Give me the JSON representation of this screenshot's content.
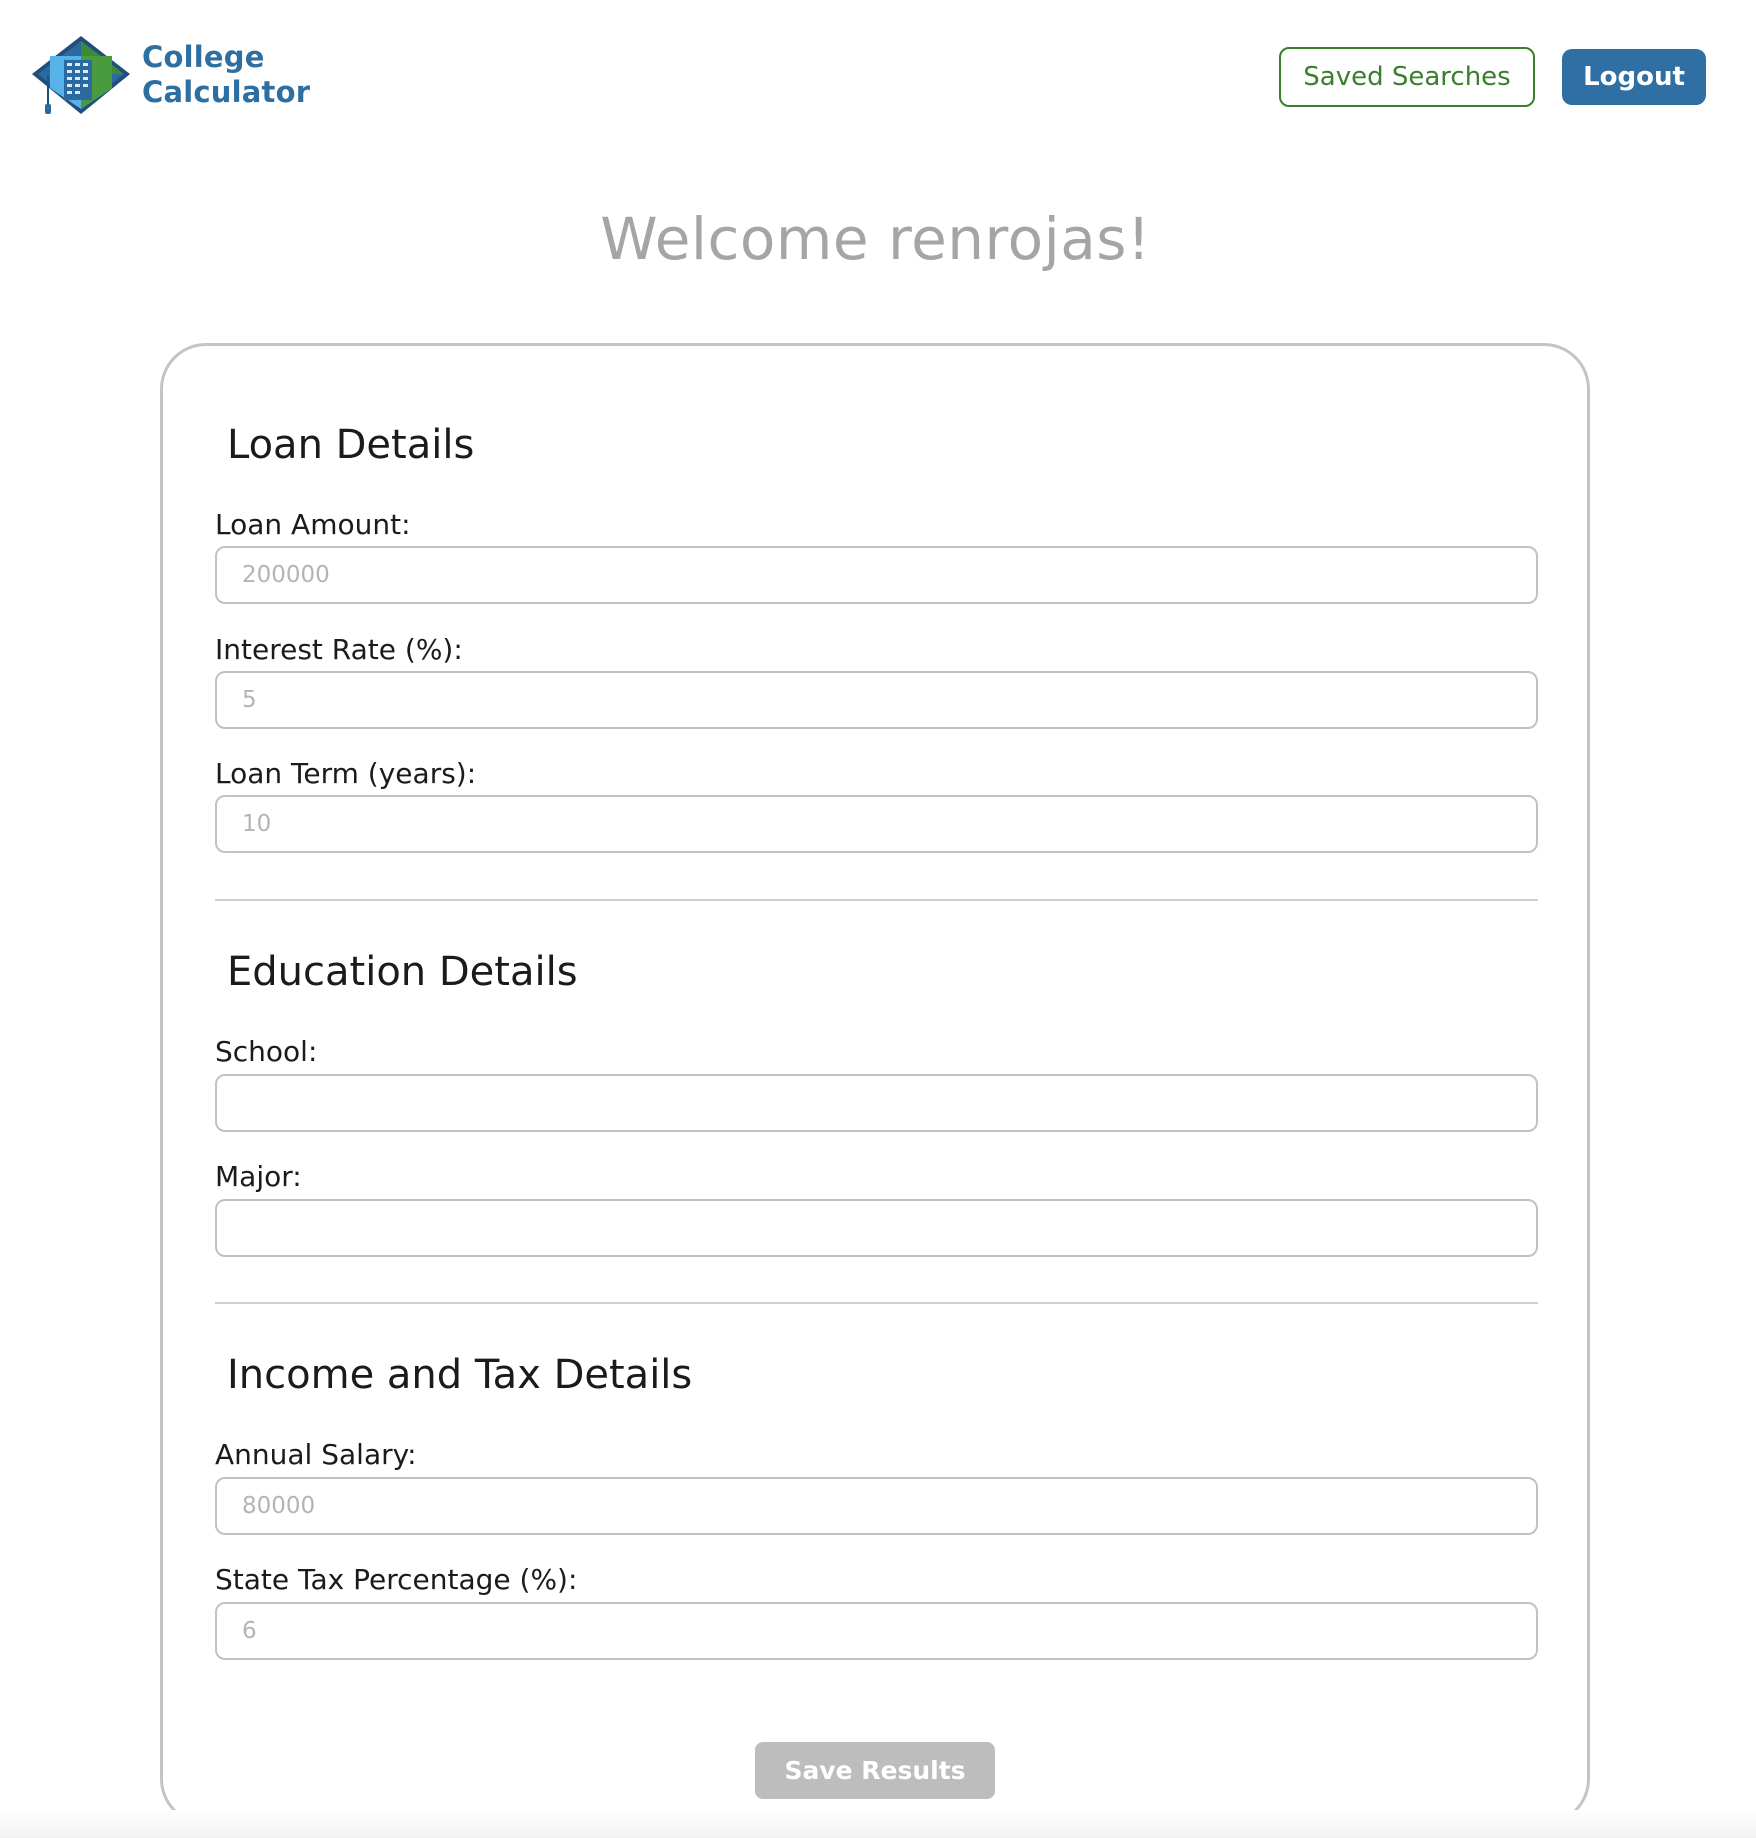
{
  "header": {
    "logo_line1": "College",
    "logo_line2": "Calculator",
    "saved_searches_label": "Saved Searches",
    "logout_label": "Logout"
  },
  "welcome": "Welcome renrojas!",
  "loan": {
    "title": "Loan Details",
    "amount_label": "Loan Amount:",
    "amount_placeholder": "200000",
    "rate_label": "Interest Rate (%):",
    "rate_placeholder": "5",
    "term_label": "Loan Term (years):",
    "term_placeholder": "10"
  },
  "education": {
    "title": "Education Details",
    "school_label": "School:",
    "school_value": "",
    "major_label": "Major:",
    "major_value": ""
  },
  "income": {
    "title": "Income and Tax Details",
    "salary_label": "Annual Salary:",
    "salary_placeholder": "80000",
    "tax_label": "State Tax Percentage (%):",
    "tax_placeholder": "6"
  },
  "save_results_label": "Save Results",
  "colors": {
    "brand_blue": "#2e6fa1",
    "brand_green": "#3a7f2c",
    "disabled_gray": "#bdbdbd"
  }
}
